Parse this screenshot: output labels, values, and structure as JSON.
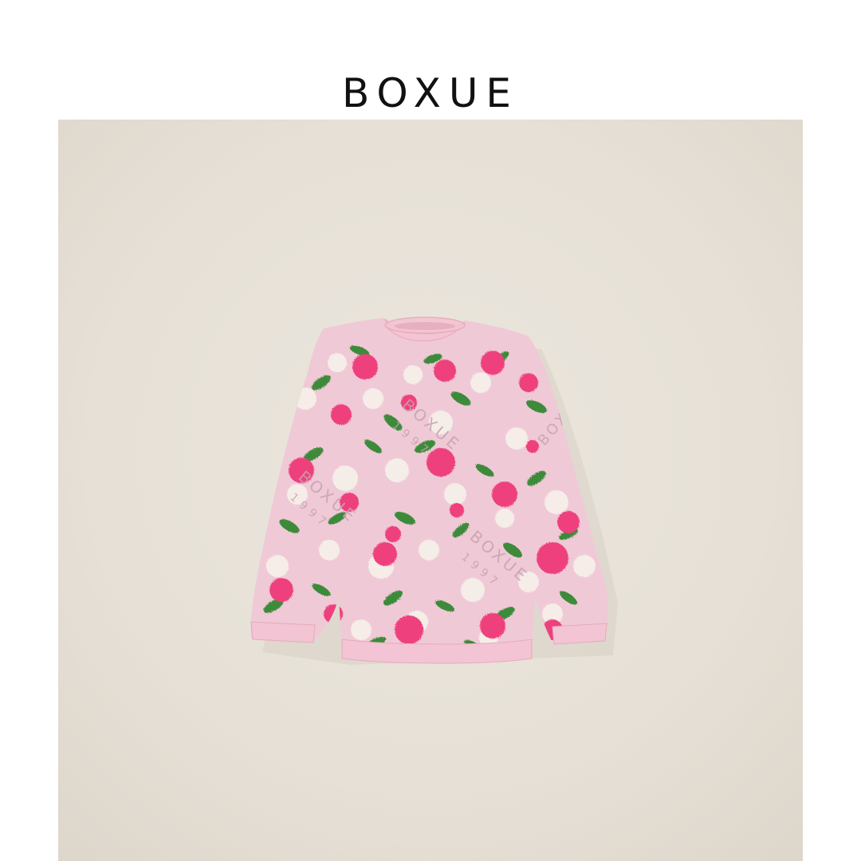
{
  "header": {
    "brand_name": "BOXUE"
  },
  "product": {
    "image_alt": "Pink floral knit sweater",
    "watermark_text": "BOXUE",
    "watermark_year": "1997"
  },
  "colors": {
    "page_background": "#ffffff",
    "photo_background": "#e7e1d8",
    "sweater_base": "#f0c9d6",
    "rose_pink": "#ee3f7c",
    "leaf_green": "#3d8a3a",
    "white_flower": "#f6f0ea",
    "rib_trim": "#f3c4d3"
  }
}
